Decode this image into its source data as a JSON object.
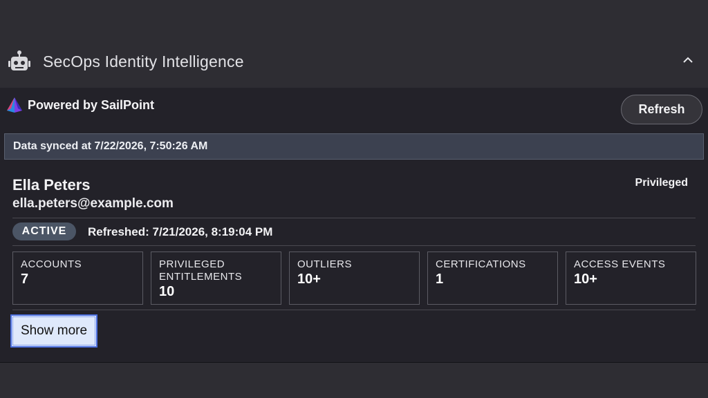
{
  "header": {
    "title": "SecOps Identity Intelligence",
    "icon": "robot-icon",
    "collapse_icon": "chevron-up-icon"
  },
  "panel": {
    "powered_by": "Powered by SailPoint",
    "refresh_label": "Refresh",
    "sync_text": "Data synced at 7/22/2026, 7:50:26 AM"
  },
  "user": {
    "name": "Ella Peters",
    "email": "ella.peters@example.com",
    "tag": "Privileged",
    "status": "ACTIVE",
    "refreshed": "Refreshed: 7/21/2026, 8:19:04 PM"
  },
  "stats": [
    {
      "label": "ACCOUNTS",
      "value": "7"
    },
    {
      "label": "PRIVILEGED ENTITLEMENTS",
      "value": "10"
    },
    {
      "label": "OUTLIERS",
      "value": "10+"
    },
    {
      "label": "CERTIFICATIONS",
      "value": "1"
    },
    {
      "label": "ACCESS EVENTS",
      "value": "10+"
    }
  ],
  "show_more_label": "Show more",
  "colors": {
    "background": "#2e2d33",
    "panel": "#232229",
    "sync_bar": "#3c4150",
    "badge": "#4b5565",
    "focus_button": "#dfe9fb",
    "focus_border": "#4b6fe0"
  }
}
